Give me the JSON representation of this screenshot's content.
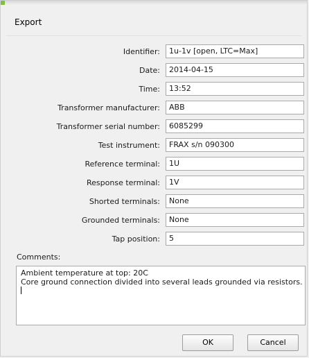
{
  "dialog": {
    "title": "Export"
  },
  "fields": [
    {
      "label": "Identifier:",
      "value": "1u-1v [open, LTC=Max]"
    },
    {
      "label": "Date:",
      "value": "2014-04-15"
    },
    {
      "label": "Time:",
      "value": "13:52"
    },
    {
      "label": "Transformer manufacturer:",
      "value": "ABB"
    },
    {
      "label": "Transformer serial number:",
      "value": "6085299"
    },
    {
      "label": "Test instrument:",
      "value": "FRAX s/n 090300"
    },
    {
      "label": "Reference terminal:",
      "value": "1U"
    },
    {
      "label": "Response terminal:",
      "value": "1V"
    },
    {
      "label": "Shorted terminals:",
      "value": "None"
    },
    {
      "label": "Grounded terminals:",
      "value": "None"
    },
    {
      "label": "Tap position:",
      "value": "5"
    }
  ],
  "comments": {
    "label": "Comments:",
    "lines": [
      "Ambient temperature at top: 20C",
      "Core ground connection divided into several leads grounded via resistors."
    ]
  },
  "buttons": {
    "ok": "OK",
    "cancel": "Cancel"
  }
}
